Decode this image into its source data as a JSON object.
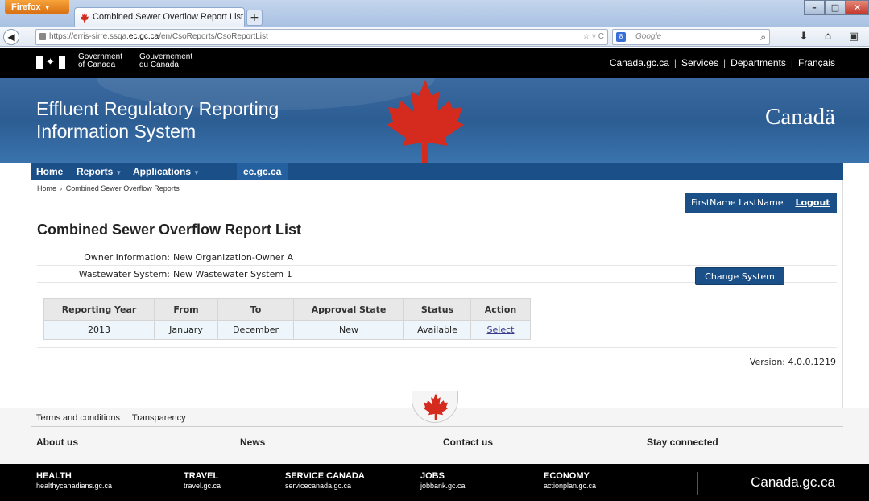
{
  "browser": {
    "app_button": "Firefox",
    "tab_title": "Combined Sewer Overflow Report List - ...",
    "new_tab": "+",
    "url_host_prefix": "https://erris-sirre.ssqa.",
    "url_host_domain": "ec.gc.ca",
    "url_path": "/en/CsoReports/CsoReportList",
    "search_placeholder": "Google",
    "colors": {
      "chrome": "#a9c1e2",
      "firefox_orange": "#e07a1c"
    }
  },
  "gov_header": {
    "government_en_1": "Government",
    "government_en_2": "of Canada",
    "government_fr_1": "Gouvernement",
    "government_fr_2": "du Canada",
    "links": [
      "Canada.gc.ca",
      "Services",
      "Departments",
      "Français"
    ]
  },
  "banner": {
    "title_line1": "Effluent Regulatory Reporting",
    "title_line2": "Information System",
    "wordmark": "Canadä"
  },
  "menu": {
    "items": [
      {
        "label": "Home",
        "has_dropdown": false
      },
      {
        "label": "Reports",
        "has_dropdown": true
      },
      {
        "label": "Applications",
        "has_dropdown": true
      },
      {
        "label": "ec.gc.ca",
        "has_dropdown": false
      }
    ]
  },
  "breadcrumb": {
    "home": "Home",
    "separator": "›",
    "current": "Combined Sewer Overflow Reports"
  },
  "user": {
    "name": "FirstName LastName",
    "logout": "Logout"
  },
  "page_title": "Combined Sewer Overflow Report List",
  "info": {
    "owner_label": "Owner Information:",
    "owner_value": "New Organization-Owner A",
    "system_label": "Wastewater System:",
    "system_value": "New Wastewater System 1",
    "change_button": "Change System"
  },
  "table": {
    "headers": [
      "Reporting Year",
      "From",
      "To",
      "Approval State",
      "Status",
      "Action"
    ],
    "rows": [
      {
        "year": "2013",
        "from": "January",
        "to": "December",
        "approval": "New",
        "status": "Available",
        "action": "Select"
      }
    ]
  },
  "version": "Version: 4.0.0.1219",
  "footer": {
    "terms": "Terms and conditions",
    "transparency": "Transparency",
    "columns": [
      "About us",
      "News",
      "Contact us",
      "Stay connected"
    ],
    "bottom_links": [
      {
        "title": "HEALTH",
        "site": "healthycanadians.gc.ca"
      },
      {
        "title": "TRAVEL",
        "site": "travel.gc.ca"
      },
      {
        "title": "SERVICE CANADA",
        "site": "servicecanada.gc.ca"
      },
      {
        "title": "JOBS",
        "site": "jobbank.gc.ca"
      },
      {
        "title": "ECONOMY",
        "site": "actionplan.gc.ca"
      }
    ],
    "site": "Canada.gc.ca"
  },
  "colors": {
    "gov_navy": "#1b4f88",
    "banner_blue": "#2c5d93",
    "maple_red": "#d52b1e"
  }
}
